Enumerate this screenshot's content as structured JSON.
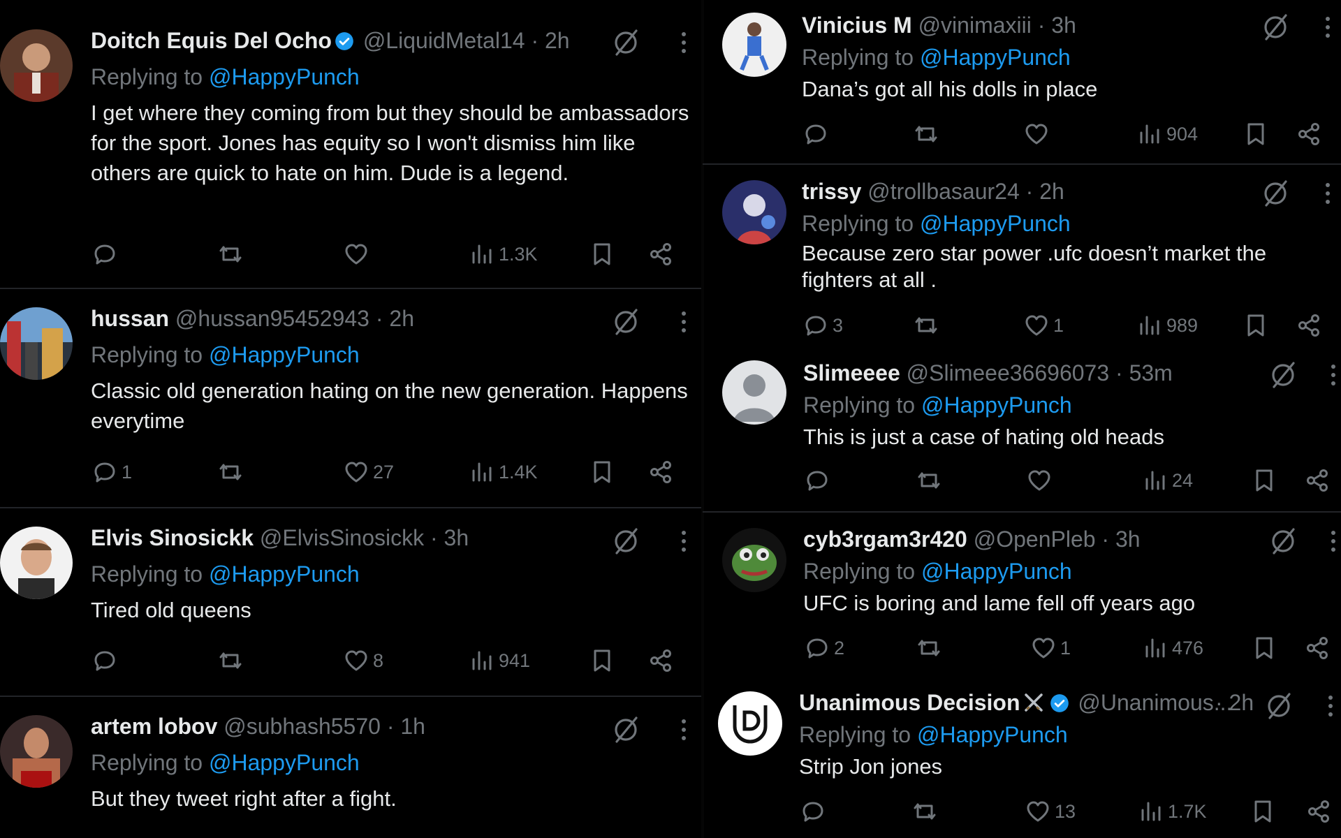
{
  "reply_prefix": "Replying to",
  "reply_target": "@HappyPunch",
  "colors": {
    "background": "#000000",
    "text": "#e7e9ea",
    "muted": "#71767b",
    "link": "#1d9bf0",
    "verified": "#1d9bf0"
  },
  "left_tweets": [
    {
      "name": "Doitch Equis Del Ocho",
      "verified": true,
      "handle": "@LiquidMetal14",
      "time": "· 2h",
      "text": "I get where they coming from but they should be ambassadors for the sport. Jones has equity so I won't dismiss him like others are quick to hate on him. Dude is a legend.",
      "replies": "",
      "reposts": "",
      "likes": "",
      "views": "1.3K"
    },
    {
      "name": "hussan",
      "verified": false,
      "handle": "@hussan95452943",
      "time": "· 2h",
      "text": "Classic old generation hating on the new generation. Happens everytime",
      "replies": "1",
      "reposts": "",
      "likes": "27",
      "views": "1.4K"
    },
    {
      "name": "Elvis Sinosickk",
      "verified": false,
      "handle": "@ElvisSinosickk",
      "time": "· 3h",
      "text": "Tired old queens",
      "replies": "",
      "reposts": "",
      "likes": "8",
      "views": "941"
    },
    {
      "name": "artem lobov",
      "verified": false,
      "handle": "@subhash5570",
      "time": "· 1h",
      "text": "But they tweet right after a fight.",
      "replies": "",
      "reposts": "",
      "likes": "",
      "views": ""
    }
  ],
  "right_tweets": [
    {
      "name": "Vinicius M",
      "verified": false,
      "handle": "@vinimaxiii",
      "time": "· 3h",
      "text": "Dana’s got all his dolls in place",
      "replies": "",
      "reposts": "",
      "likes": "",
      "views": "904"
    },
    {
      "name": "trissy",
      "verified": false,
      "handle": "@trollbasaur24",
      "time": "· 2h",
      "text": "Because zero star power .ufc doesn’t market the fighters at all .",
      "replies": "3",
      "reposts": "",
      "likes": "1",
      "views": "989"
    },
    {
      "name": "Slimeeee",
      "verified": false,
      "handle": "@Slimeee36696073",
      "time": "· 53m",
      "text": "This is just a case of hating old heads",
      "replies": "",
      "reposts": "",
      "likes": "",
      "views": "24"
    },
    {
      "name": "cyb3rgam3r420",
      "verified": false,
      "handle": "@OpenPleb",
      "time": "· 3h",
      "text": "UFC is boring and lame fell off years ago",
      "replies": "2",
      "reposts": "",
      "likes": "1",
      "views": "476"
    },
    {
      "name": "Unanimous Decision",
      "verified": true,
      "name_emoji": "crossed-swords-emoji",
      "handle": "@Unanimous...",
      "time": "· 2h",
      "text": "Strip Jon jones",
      "replies": "",
      "reposts": "",
      "likes": "13",
      "views": "1.7K"
    }
  ]
}
